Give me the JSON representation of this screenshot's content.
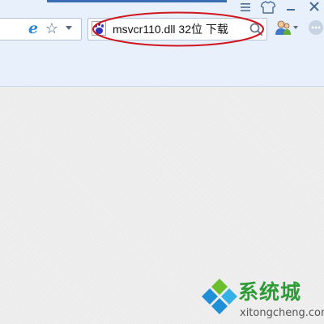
{
  "toolbar": {
    "address_bar": {
      "ie_icon": "ie-icon",
      "favorite_icon": "star-icon",
      "dropdown_icon": "chevron-down-icon"
    },
    "search": {
      "engine_icon": "baidu-paw-icon",
      "query": "msvcr110.dll 32位 下载",
      "button_icon": "search-icon"
    },
    "window_controls": [
      "menu-icon",
      "skin-icon",
      "minimize-icon",
      "close-icon"
    ],
    "user_menu_icon": "user-icon",
    "more_icon": "more-icon"
  },
  "annotation": {
    "highlight_color": "#d0161f"
  },
  "watermark": {
    "brand": "系统城",
    "domain": "xitongcheng.com",
    "logo_colors": [
      "#1f8fd8",
      "#36b1e8",
      "#6bbf2c"
    ]
  },
  "colors": {
    "toolbar_background": "#e7f0fb",
    "page_background": "#efefef",
    "brand_green": "#2e9c36"
  }
}
